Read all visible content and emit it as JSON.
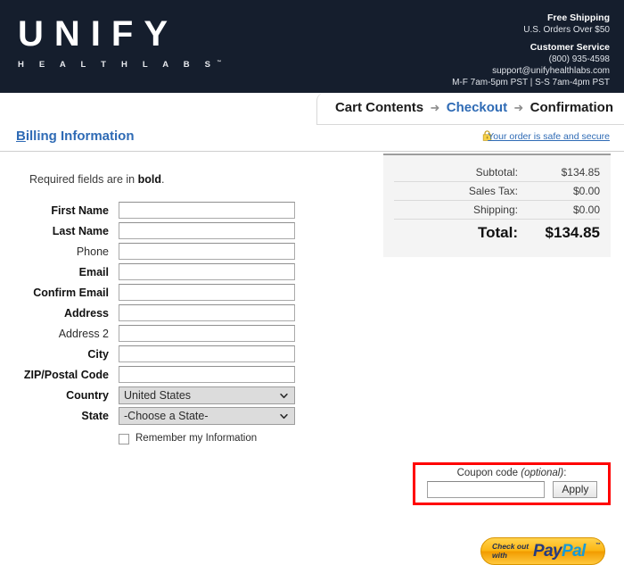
{
  "header": {
    "logo_word": "UNIFY",
    "logo_sub": "H E A L T H    L A B S",
    "logo_tm": "™",
    "free_shipping_title": "Free Shipping",
    "free_shipping_text": "U.S. Orders Over $50",
    "customer_service_title": "Customer Service",
    "phone": "(800) 935-4598",
    "email": "support@unifyhealthlabs.com",
    "hours": "M-F 7am-5pm PST | S-S 7am-4pm PST"
  },
  "breadcrumb": {
    "items": [
      {
        "label": "Cart Contents",
        "is_link": false
      },
      {
        "label": "Checkout",
        "is_link": true
      },
      {
        "label": "Confirmation",
        "is_link": false
      }
    ],
    "separator": "➜"
  },
  "billing": {
    "title_first": "B",
    "title_rest": "illing Information",
    "secure_note": "Your order is safe and secure",
    "lock_icon": "lock-icon",
    "required_note_prefix": "Required fields are in ",
    "required_note_bold": "bold",
    "required_note_suffix": "."
  },
  "form": {
    "fields": [
      {
        "label": "First Name",
        "required": true,
        "type": "text",
        "value": "",
        "name": "first-name"
      },
      {
        "label": "Last Name",
        "required": true,
        "type": "text",
        "value": "",
        "name": "last-name"
      },
      {
        "label": "Phone",
        "required": false,
        "type": "text",
        "value": "",
        "name": "phone"
      },
      {
        "label": "Email",
        "required": true,
        "type": "text",
        "value": "",
        "name": "email"
      },
      {
        "label": "Confirm Email",
        "required": true,
        "type": "text",
        "value": "",
        "name": "confirm-email"
      },
      {
        "label": "Address",
        "required": true,
        "type": "text",
        "value": "",
        "name": "address"
      },
      {
        "label": "Address 2",
        "required": false,
        "type": "text",
        "value": "",
        "name": "address-2"
      },
      {
        "label": "City",
        "required": true,
        "type": "text",
        "value": "",
        "name": "city"
      },
      {
        "label": "ZIP/Postal Code",
        "required": true,
        "type": "text",
        "value": "",
        "name": "zip-postal-code"
      },
      {
        "label": "Country",
        "required": true,
        "type": "select",
        "value": "United States",
        "name": "country"
      },
      {
        "label": "State",
        "required": true,
        "type": "select",
        "value": "-Choose a State-",
        "name": "state"
      }
    ],
    "remember_label": "Remember my Information",
    "remember_checked": false
  },
  "summary": {
    "rows": [
      {
        "label": "Subtotal:",
        "value": "$134.85"
      },
      {
        "label": "Sales Tax:",
        "value": "$0.00"
      },
      {
        "label": "Shipping:",
        "value": "$0.00"
      }
    ],
    "total_label": "Total:",
    "total_value": "$134.85"
  },
  "coupon": {
    "label_text": "Coupon code ",
    "label_optional": "(optional)",
    "label_colon": ":",
    "value": "",
    "apply_label": "Apply",
    "highlight_color": "#ff0000"
  },
  "paypal": {
    "check_out": "Check out",
    "with": "with",
    "pay": "Pay",
    "pal": "Pal",
    "tm": "™"
  },
  "colors": {
    "header_navy": "#151e2d",
    "link_blue": "#2f6bb5",
    "panel_gray": "#f4f4f4",
    "paypal_yellow": "#fcb614"
  }
}
